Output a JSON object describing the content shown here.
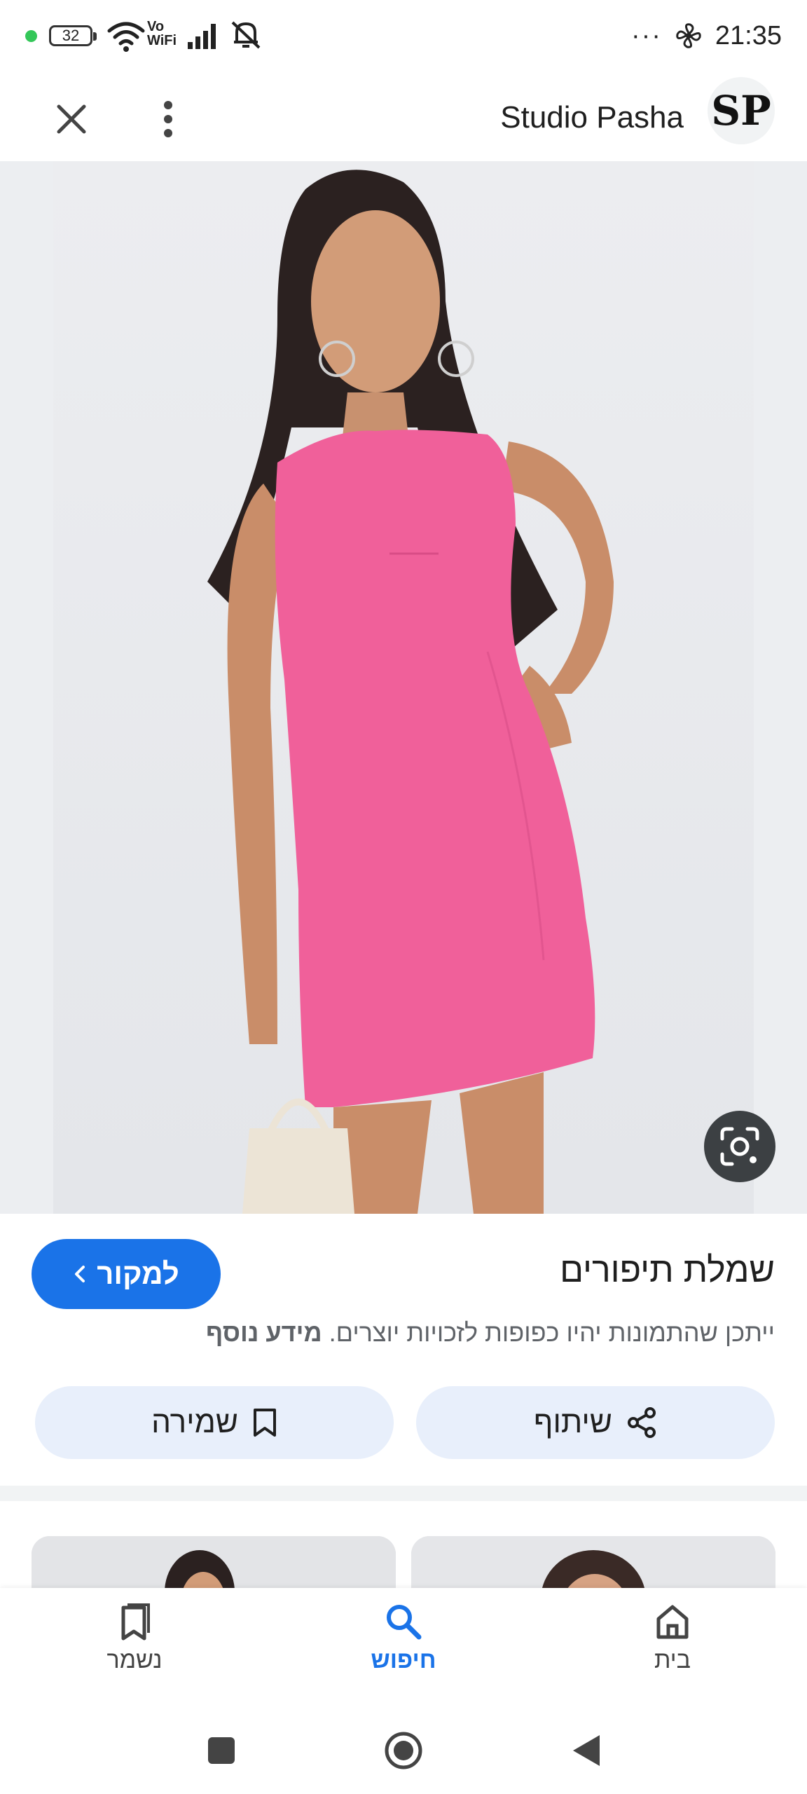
{
  "status_bar": {
    "battery": "32",
    "vowifi_top": "Vo",
    "vowifi_bottom": "WiFi",
    "overflow": "···",
    "time": "21:35"
  },
  "header": {
    "site_name": "Studio Pasha",
    "logo_text": "SP",
    "close_icon": "close-icon",
    "more_icon": "more-vert-icon"
  },
  "result": {
    "title": "שמלת תיפורים",
    "visit_label": "למקור",
    "notice_text": "ייתכן שהתמונות יהיו כפופות לזכויות יוצרים.",
    "notice_link": "מידע נוסף",
    "share_label": "שיתוף",
    "save_label": "שמירה"
  },
  "bottom_nav": {
    "items": [
      {
        "label": "בית",
        "icon": "home-icon"
      },
      {
        "label": "חיפוש",
        "icon": "search-icon",
        "active": true
      },
      {
        "label": "נשמר",
        "icon": "saved-icon"
      }
    ]
  },
  "colors": {
    "accent": "#1a73e8",
    "dress": "#f0609a",
    "chip_bg": "#e8effb"
  }
}
